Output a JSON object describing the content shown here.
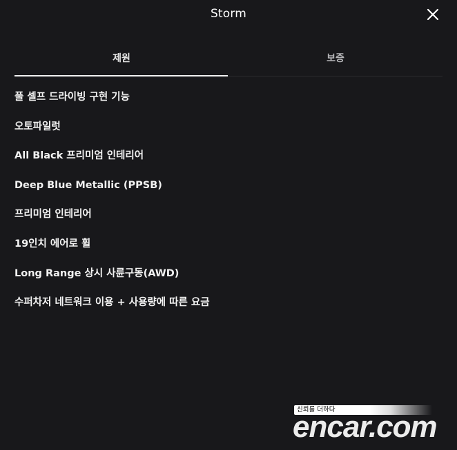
{
  "header": {
    "title": "Storm"
  },
  "tabs": [
    {
      "label": "제원",
      "active": true
    },
    {
      "label": "보증",
      "active": false
    }
  ],
  "features": [
    "풀 셀프 드라이빙 구현 기능",
    "오토파일럿",
    "All Black 프리미엄 인테리어",
    "Deep Blue Metallic (PPSB)",
    "프리미엄 인테리어",
    "19인치 에어로 휠",
    "Long Range 상시 사륜구동(AWD)",
    "수퍼차저 네트워크 이용 + 사용량에 따른 요금"
  ],
  "watermark": {
    "tagline": "신뢰를 더하다",
    "logo": "encar.com"
  },
  "colors": {
    "background": "#18181b",
    "text": "#ffffff",
    "inactive_tab": "#b5b5b8",
    "divider": "#2a2a2e"
  }
}
